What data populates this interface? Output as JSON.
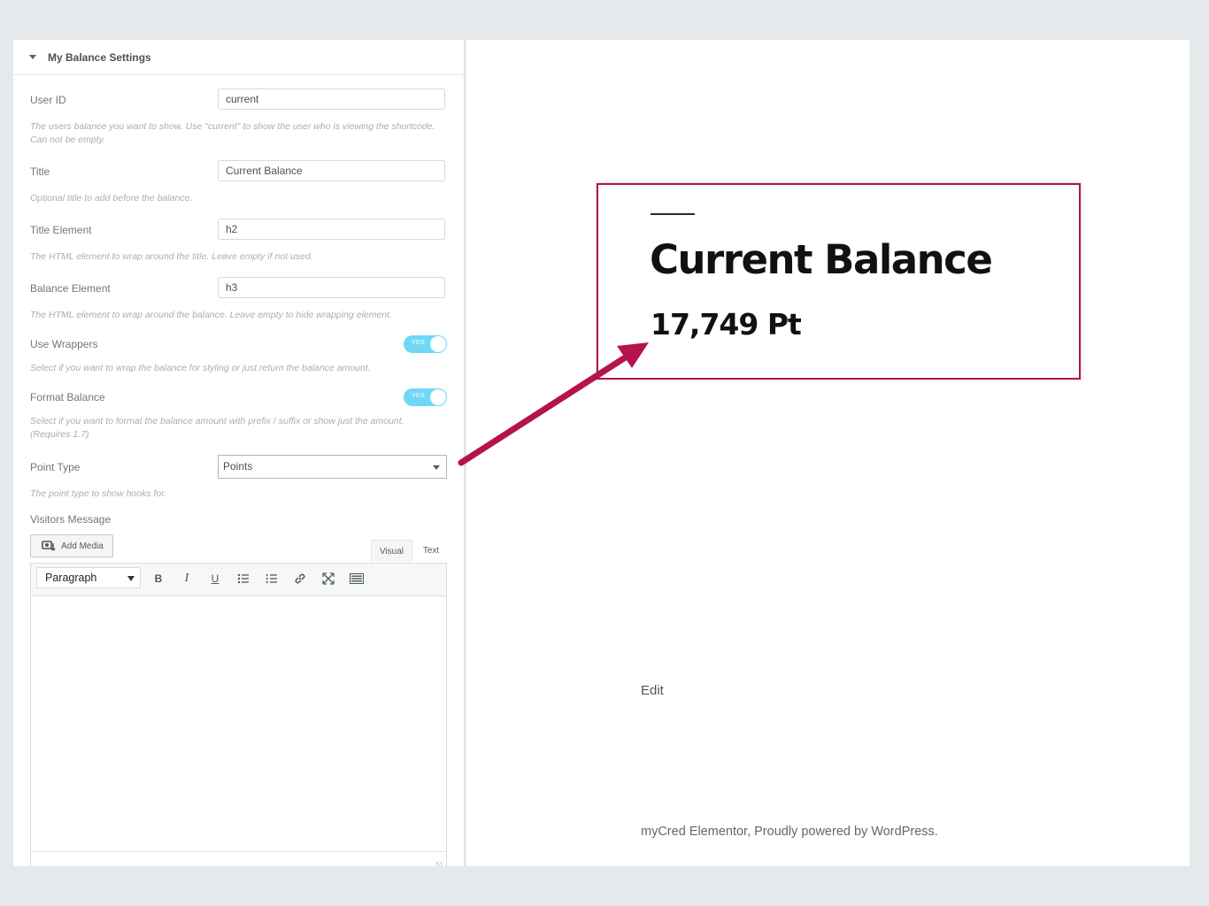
{
  "panel": {
    "title": "My Balance Settings",
    "fields": {
      "user_id": {
        "label": "User ID",
        "value": "current",
        "description": "The users balance you want to show. Use \"current\" to show the user who is viewing the shortcode. Can not be empty."
      },
      "title": {
        "label": "Title",
        "value": "Current Balance",
        "description": "Optional title to add before the balance."
      },
      "title_element": {
        "label": "Title Element",
        "value": "h2",
        "description": "The HTML element to wrap around the title. Leave empty if not used."
      },
      "balance_element": {
        "label": "Balance Element",
        "value": "h3",
        "description": "The HTML element to wrap around the balance. Leave empty to hide wrapping element."
      },
      "use_wrappers": {
        "label": "Use Wrappers",
        "toggle_text": "YES",
        "description": "Select if you want to wrap the balance for styling or just return the balance amount."
      },
      "format_balance": {
        "label": "Format Balance",
        "toggle_text": "YES",
        "description": "Select if you want to format the balance amount with prefix / suffix or show just the amount. (Requires 1.7)"
      },
      "point_type": {
        "label": "Point Type",
        "selected": "Points",
        "description": "The point type to show hooks for."
      },
      "visitors_message": {
        "label": "Visitors Message"
      }
    },
    "editor": {
      "add_media_label": "Add Media",
      "tab_visual": "Visual",
      "tab_text": "Text",
      "format_select": "Paragraph",
      "toolbar": {
        "bold": "B",
        "italic": "I",
        "underline": "U"
      }
    }
  },
  "preview": {
    "title": "Current Balance",
    "amount": "17,749 Pt",
    "edit_link": "Edit",
    "footer": "myCred Elementor, Proudly powered by WordPress."
  },
  "colors": {
    "accent_highlight": "#b5134e",
    "toggle_on": "#71d7f7",
    "panel_bg": "#ffffff",
    "page_bg": "#e6e9eb"
  }
}
